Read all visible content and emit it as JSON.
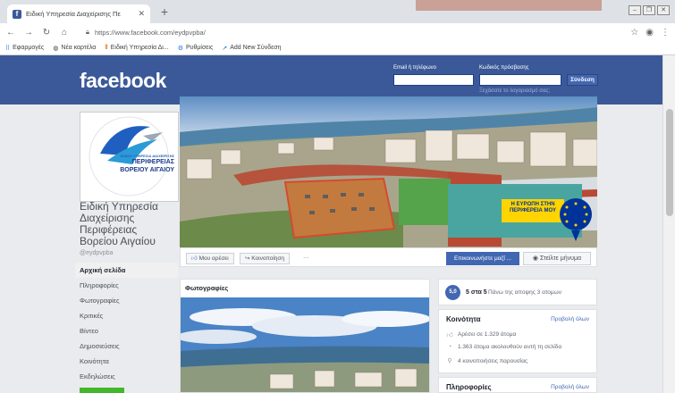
{
  "browser": {
    "tab_title": "Ειδική Υπηρεσία Διαχείρισης Πε",
    "tab_close": "✕",
    "new_tab": "+",
    "url": "https://www.facebook.com/eydpvpba/",
    "bookmarks": [
      {
        "icon": "apps-icon",
        "label": "Εφαρμογές"
      },
      {
        "icon": "globe-icon",
        "label": "Νέα καρτέλα"
      },
      {
        "icon": "bars-icon",
        "label": "Ειδική Υπηρεσία Δι..."
      },
      {
        "icon": "gear-icon",
        "label": "Ρυθμίσεις"
      },
      {
        "icon": "arrow-icon",
        "label": "Add New Σύνδεση"
      }
    ]
  },
  "header": {
    "logo": "facebook",
    "email_label": "Email ή τηλέφωνο",
    "password_label": "Κωδικός πρόσβασης",
    "login_button": "Σύνδεση",
    "forgot_link": "Ξεχάσατε το λογαριασμό σας;"
  },
  "page": {
    "avatar_lines": [
      "ΕΙΔΙΚΗ ΥΠΗΡΕΣΙΑ ΔΙΑΧΕΙΡΙΣΗΣ",
      "ΠΕΡΙΦΕΡΕΙΑΣ",
      "ΒΟΡΕΙΟΥ ΑΙΓΑΙΟΥ"
    ],
    "name_lines": [
      "Ειδική Υπηρεσία",
      "Διαχείρισης",
      "Περιφέρειας",
      "Βορείου Αιγαίου"
    ],
    "handle": "@eydpvpba",
    "nav": [
      "Αρχική σελίδα",
      "Πληροφορίες",
      "Φωτογραφίες",
      "Κριτικές",
      "Βίντεο",
      "Δημοσιεύσεις",
      "Κοινότητα",
      "Εκδηλώσεις"
    ],
    "cover_sign": [
      "Η ΕΥΡΩΠΗ ΣΤΗΝ",
      "ΠΕΡΙΦΕΡΕΙΑ ΜΟΥ"
    ]
  },
  "actions": {
    "like": "Μου αρέσει",
    "share": "Κοινοποίηση",
    "more": "···",
    "contact": "Επικοινωνήστε μαζί ...",
    "message": "Στείλτε μήνυμα"
  },
  "photos": {
    "title": "Φωτογραφίες"
  },
  "rating": {
    "badge": "5,0",
    "score": "5 στα 5",
    "detail": "Πάνω της αποψης 3 ατομων"
  },
  "community": {
    "title": "Κοινότητα",
    "see_all": "Προβολή όλων",
    "rows": [
      {
        "icon": "like-icon",
        "text": "Αρέσει σε 1.329 άτομα"
      },
      {
        "icon": "rss-icon",
        "text": "1.363 άτομα ακολουθούν αυτή τη σελίδα"
      },
      {
        "icon": "checkin-icon",
        "text": "4 κοινοποιήσεις παρουσίας"
      }
    ]
  },
  "info": {
    "title": "Πληροφορίες",
    "see_all": "Προβολή όλων"
  },
  "colors": {
    "facebook_blue": "#3b5998",
    "body_bg": "#e9ebee",
    "button_blue": "#4267b2",
    "green": "#42b72a"
  }
}
